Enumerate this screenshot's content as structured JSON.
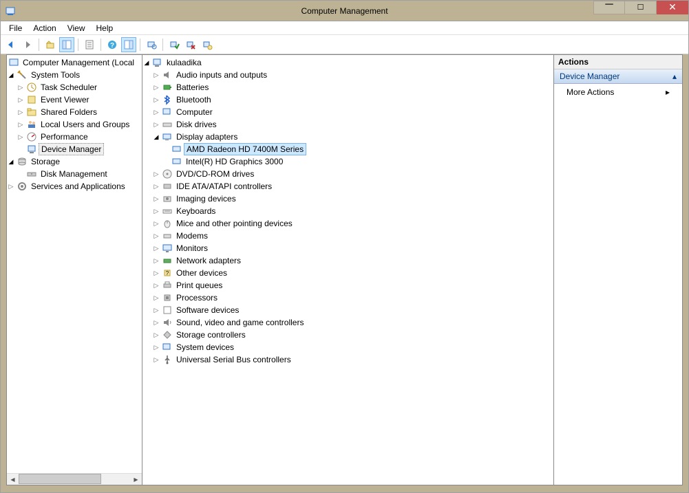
{
  "window": {
    "title": "Computer Management"
  },
  "menu": {
    "file": "File",
    "action": "Action",
    "view": "View",
    "help": "Help"
  },
  "left_tree": {
    "root": "Computer Management (Local",
    "system_tools": "System Tools",
    "task_scheduler": "Task Scheduler",
    "event_viewer": "Event Viewer",
    "shared_folders": "Shared Folders",
    "local_users": "Local Users and Groups",
    "performance": "Performance",
    "device_manager": "Device Manager",
    "storage": "Storage",
    "disk_management": "Disk Management",
    "services_apps": "Services and Applications"
  },
  "center_tree": {
    "root": "kulaadika",
    "audio": "Audio inputs and outputs",
    "batteries": "Batteries",
    "bluetooth": "Bluetooth",
    "computer": "Computer",
    "disk_drives": "Disk drives",
    "display_adapters": "Display adapters",
    "amd_radeon": "AMD Radeon HD 7400M Series",
    "intel_hd": "Intel(R) HD Graphics 3000",
    "dvd": "DVD/CD-ROM drives",
    "ide": "IDE ATA/ATAPI controllers",
    "imaging": "Imaging devices",
    "keyboards": "Keyboards",
    "mice": "Mice and other pointing devices",
    "modems": "Modems",
    "monitors": "Monitors",
    "network": "Network adapters",
    "other": "Other devices",
    "print_queues": "Print queues",
    "processors": "Processors",
    "software": "Software devices",
    "sound": "Sound, video and game controllers",
    "storage_ctrl": "Storage controllers",
    "system_devices": "System devices",
    "usb": "Universal Serial Bus controllers"
  },
  "actions": {
    "header": "Actions",
    "section": "Device Manager",
    "more": "More Actions"
  }
}
